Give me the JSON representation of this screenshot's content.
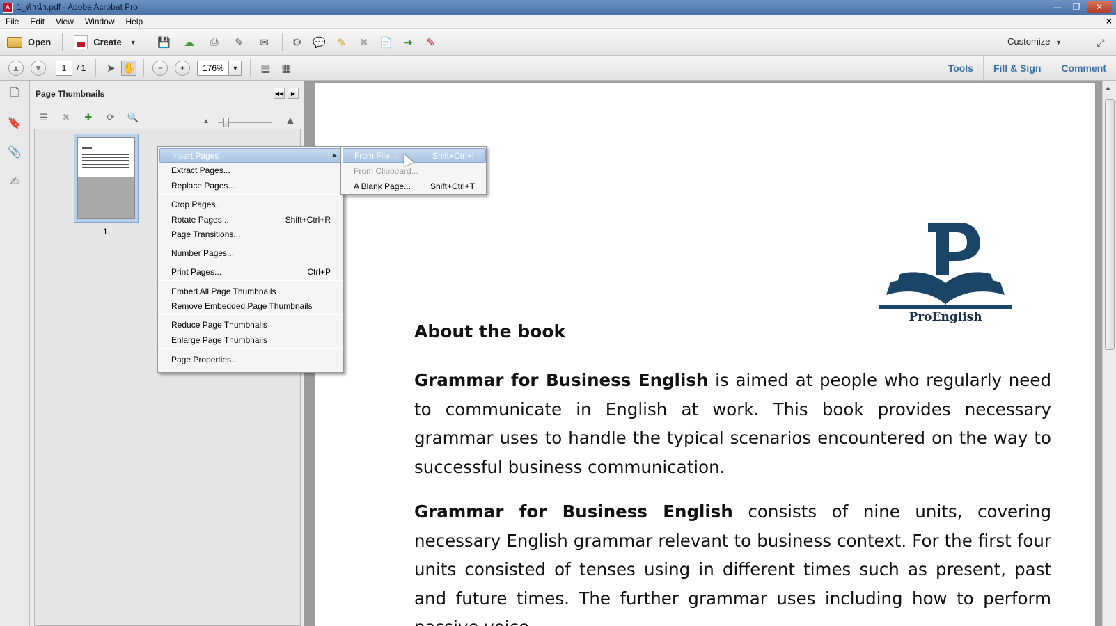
{
  "window": {
    "title": "1_คำนำ.pdf - Adobe Acrobat Pro",
    "icon": "acrobat-icon"
  },
  "menubar": {
    "items": [
      "File",
      "Edit",
      "View",
      "Window",
      "Help"
    ]
  },
  "toolbar": {
    "open_label": "Open",
    "create_label": "Create",
    "customize_label": "Customize"
  },
  "navbar": {
    "current_page": "1",
    "page_total": "/ 1",
    "zoom": "176%",
    "tools_label": "Tools",
    "fill_sign_label": "Fill & Sign",
    "comment_label": "Comment"
  },
  "panel": {
    "title": "Page Thumbnails",
    "thumbnail_label": "1"
  },
  "context_menu": {
    "items": [
      {
        "label": "Insert Pages",
        "shortcut": "",
        "submenu": true
      },
      {
        "label": "Extract Pages...",
        "shortcut": ""
      },
      {
        "label": "Replace Pages...",
        "shortcut": ""
      },
      {
        "label": "Crop Pages...",
        "shortcut": ""
      },
      {
        "label": "Rotate Pages...",
        "shortcut": "Shift+Ctrl+R"
      },
      {
        "label": "Page Transitions...",
        "shortcut": ""
      },
      {
        "label": "Number Pages...",
        "shortcut": ""
      },
      {
        "label": "Print Pages...",
        "shortcut": "Ctrl+P"
      },
      {
        "label": "Embed All Page Thumbnails",
        "shortcut": ""
      },
      {
        "label": "Remove Embedded Page Thumbnails",
        "shortcut": ""
      },
      {
        "label": "Reduce Page Thumbnails",
        "shortcut": ""
      },
      {
        "label": "Enlarge Page Thumbnails",
        "shortcut": ""
      },
      {
        "label": "Page Properties...",
        "shortcut": ""
      }
    ]
  },
  "submenu": {
    "items": [
      {
        "label": "From File...",
        "shortcut": "Shift+Ctrl+I"
      },
      {
        "label": "From Clipboard...",
        "shortcut": ""
      },
      {
        "label": "A Blank Page...",
        "shortcut": "Shift+Ctrl+T"
      }
    ]
  },
  "document": {
    "logo_letter": "P",
    "logo_text": "ProEnglish",
    "heading": "About the book",
    "para1_bold": "Grammar for Business English",
    "para1_rest": " is aimed at people who regularly need to communicate in English at work. This book provides necessary grammar uses to handle the typical scenarios encountered on the way to successful business communication.",
    "para2_bold": "Grammar for Business English",
    "para2_rest": " consists of nine units, covering necessary English grammar relevant to business context. For the first four units consisted of tenses using in different times such as present, past and future times. The further grammar uses including how to perform passive voice"
  },
  "colors": {
    "link_blue": "#3a6fa8",
    "logo_navy": "#1b4566",
    "menu_highlight": "#a9c3e3"
  }
}
